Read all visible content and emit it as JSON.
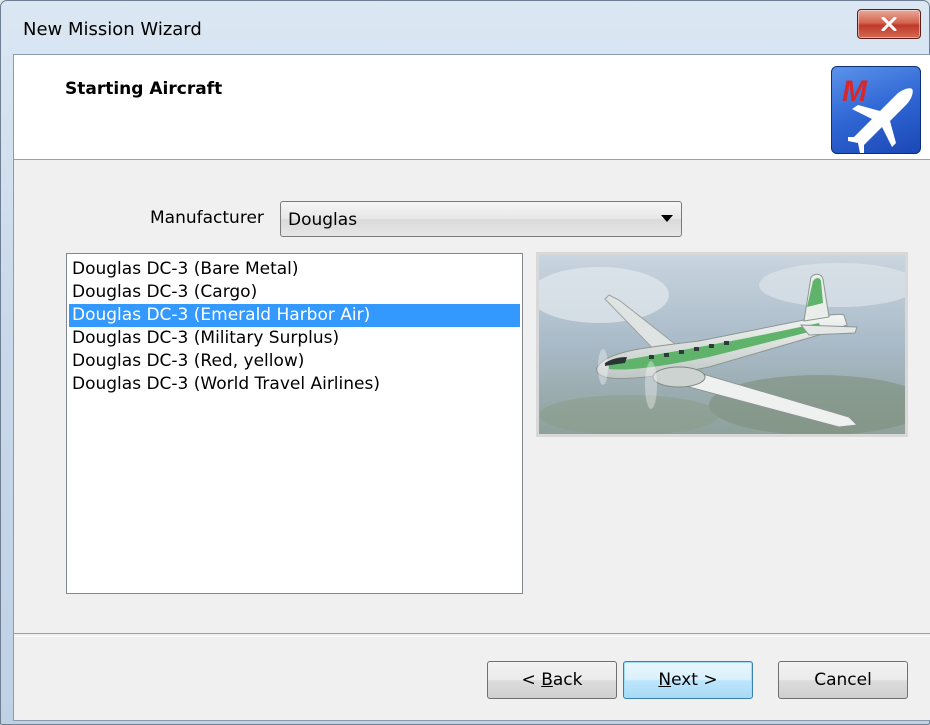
{
  "window": {
    "title": "New Mission Wizard"
  },
  "header": {
    "title": "Starting Aircraft",
    "logo_letter": "M"
  },
  "manufacturer": {
    "label": "Manufacturer",
    "selected": "Douglas"
  },
  "aircraft_list": {
    "items": [
      "Douglas DC-3 (Bare Metal)",
      "Douglas DC-3 (Cargo)",
      "Douglas DC-3 (Emerald Harbor Air)",
      "Douglas DC-3 (Military Surplus)",
      "Douglas DC-3 (Red, yellow)",
      "Douglas DC-3 (World Travel Airlines)"
    ],
    "selected_index": 2
  },
  "buttons": {
    "back_prefix": "< ",
    "back_mnemonic": "B",
    "back_rest": "ack",
    "next_mnemonic": "N",
    "next_rest": "ext >",
    "cancel": "Cancel"
  },
  "colors": {
    "selection": "#3399ff",
    "accent_logo": "#2f66d4",
    "close_button": "#c0392b"
  },
  "icons": {
    "close": "close-icon",
    "dropdown": "chevron-down-icon",
    "logo": "airplane-logo-icon"
  }
}
